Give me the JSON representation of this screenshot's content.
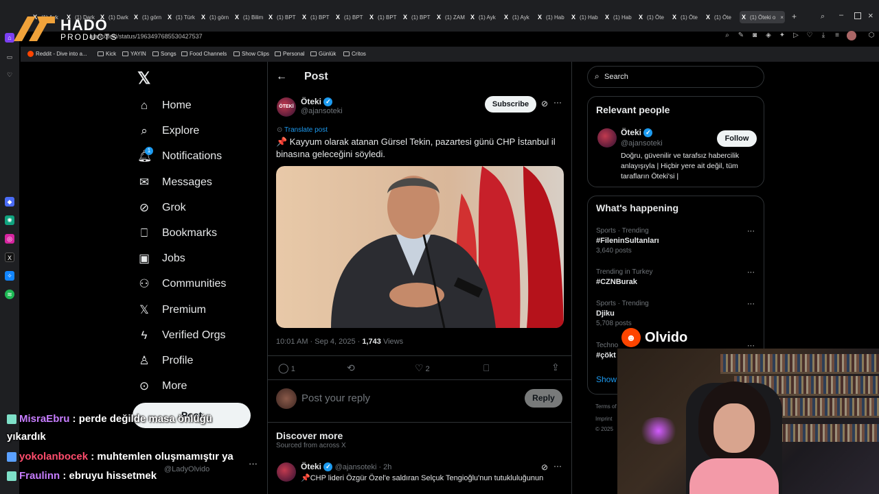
{
  "browser": {
    "tabs": [
      "(1) Ayk",
      "(1) Dark",
      "(1) Dark",
      "(1) görn",
      "(1) Türk",
      "(1) görn",
      "(1) Bilim",
      "(1) BPT",
      "(1) BPT",
      "(1) BPT",
      "(1) BPT",
      "(1) BPT",
      "(1) ZAM",
      "(1) Ayk",
      "(1) Ayk",
      "(1) Hab",
      "(1) Hab",
      "(1) Hab",
      "(1) Öte",
      "(1) Öte",
      "(1) Öte"
    ],
    "active_tab": "(1) Öteki o",
    "url": "ajansoteki/status/1963497685530427537",
    "bookmarks": [
      "Reddit - Dive into a...",
      "Kick",
      "YAYIN",
      "Songs",
      "Food Channels",
      "Show Clips",
      "Personal",
      "Günlük",
      "Critos"
    ]
  },
  "overlay_logo": {
    "title": "HADO",
    "subtitle": "PRODUCTS"
  },
  "nav": {
    "items": [
      {
        "label": "Home",
        "icon": "home-icon"
      },
      {
        "label": "Explore",
        "icon": "search-icon"
      },
      {
        "label": "Notifications",
        "icon": "bell-icon",
        "badge": "1"
      },
      {
        "label": "Messages",
        "icon": "mail-icon"
      },
      {
        "label": "Grok",
        "icon": "grok-icon"
      },
      {
        "label": "Bookmarks",
        "icon": "bookmark-icon"
      },
      {
        "label": "Jobs",
        "icon": "briefcase-icon"
      },
      {
        "label": "Communities",
        "icon": "people-icon"
      },
      {
        "label": "Premium",
        "icon": "x-logo-icon"
      },
      {
        "label": "Verified Orgs",
        "icon": "lightning-icon"
      },
      {
        "label": "Profile",
        "icon": "person-icon"
      },
      {
        "label": "More",
        "icon": "more-circle-icon"
      }
    ],
    "post_button": "Post",
    "account_handle": "@LadyOlvido"
  },
  "header": {
    "title": "Post"
  },
  "post": {
    "author_name": "Öteki",
    "author_handle": "@ajansoteki",
    "subscribe_label": "Subscribe",
    "translate": "Translate post",
    "text": "📌 Kayyum olarak atanan Gürsel Tekin, pazartesi günü CHP İstanbul il binasına geleceğini söyledi.",
    "timestamp": "10:01 AM · Sep 4, 2025 · ",
    "views_count": "1,743",
    "views_label": " Views",
    "replies": "1",
    "likes": "2"
  },
  "reply_box": {
    "placeholder": "Post your reply",
    "button": "Reply"
  },
  "discover": {
    "title": "Discover more",
    "subtitle": "Sourced from across X",
    "item": {
      "author": "Öteki",
      "handle": "@ajansoteki · 2h",
      "text": "📌CHP lideri Özgür Özel'e saldıran Selçuk Tengioğlu'nun tutukluluğunun"
    }
  },
  "search": {
    "placeholder": "Search"
  },
  "relevant": {
    "title": "Relevant people",
    "name": "Öteki",
    "handle": "@ajansoteki",
    "follow": "Follow",
    "bio": "Doğru, güvenilir ve tarafsız habercilik anlayışıyla | Hiçbir yere ait değil, tüm tarafların Öteki'si |"
  },
  "trends": {
    "title": "What's happening",
    "items": [
      {
        "category": "Sports · Trending",
        "name": "#FileninSultanları",
        "posts": "3,640 posts"
      },
      {
        "category": "Trending in Turkey",
        "name": "#CZNBurak",
        "posts": ""
      },
      {
        "category": "Sports · Trending",
        "name": "Djiku",
        "posts": "5,708 posts"
      },
      {
        "category": "Techno",
        "name": "#çökt",
        "posts": ""
      }
    ],
    "show_more": "Show",
    "footer1": "Terms of",
    "footer2": "Imprint",
    "footer3": "© 2025"
  },
  "streamer": {
    "name": "Olvido"
  },
  "chat": [
    {
      "user": "MisraEbru",
      "color": "#c77dff",
      "message": " : perde değilde masa önlüğü"
    },
    {
      "user": "",
      "color": "#ffffff",
      "message": "yıkardık"
    },
    {
      "user": "yokolanbocek",
      "color": "#ff4d6d",
      "message": " : muhtemlen oluşmamıştır ya"
    },
    {
      "user": "Fraulinn",
      "color": "#c77dff",
      "message": " : ebruyu hissetmek"
    }
  ]
}
